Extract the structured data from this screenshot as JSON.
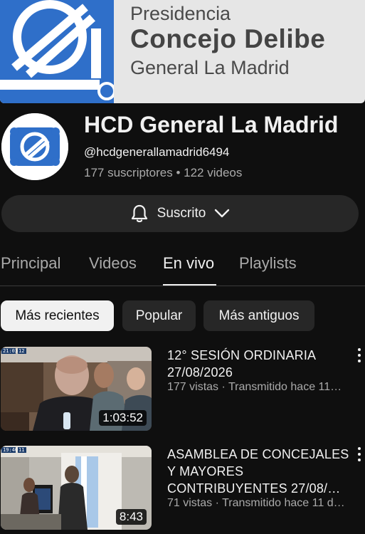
{
  "banner": {
    "line1": "Presidencia",
    "line2": "Concejo Delibe",
    "line3": "General La Madrid"
  },
  "channel": {
    "name": "HCD General La Madrid",
    "handle": "@hcdgenerallamadrid6494",
    "stats": "177 suscriptores • 122 videos",
    "subscribe_label": "Suscrito",
    "subscribe_icon": "bell-icon",
    "brand_color": "#2f6fc9"
  },
  "tabs": [
    {
      "label": "Principal",
      "active": false
    },
    {
      "label": "Videos",
      "active": false
    },
    {
      "label": "En vivo",
      "active": true
    },
    {
      "label": "Playlists",
      "active": false
    }
  ],
  "chips": [
    {
      "label": "Más recientes",
      "active": true
    },
    {
      "label": "Popular",
      "active": false
    },
    {
      "label": "Más antiguos",
      "active": false
    }
  ],
  "videos": [
    {
      "title": "12° SESIÓN ORDINARIA 27/08/2026",
      "meta": "177 vistas · Transmitido hace 11…",
      "duration": "1:03:52",
      "overlay_time": "21:03",
      "overlay_sub": "12"
    },
    {
      "title": "ASAMBLEA DE CONCEJALES Y MAYORES CONTRIBUYENTES 27/08/…",
      "meta": "71 vistas · Transmitido hace 11 d…",
      "duration": "8:43",
      "overlay_time": "19:40",
      "overlay_sub": "11"
    }
  ]
}
